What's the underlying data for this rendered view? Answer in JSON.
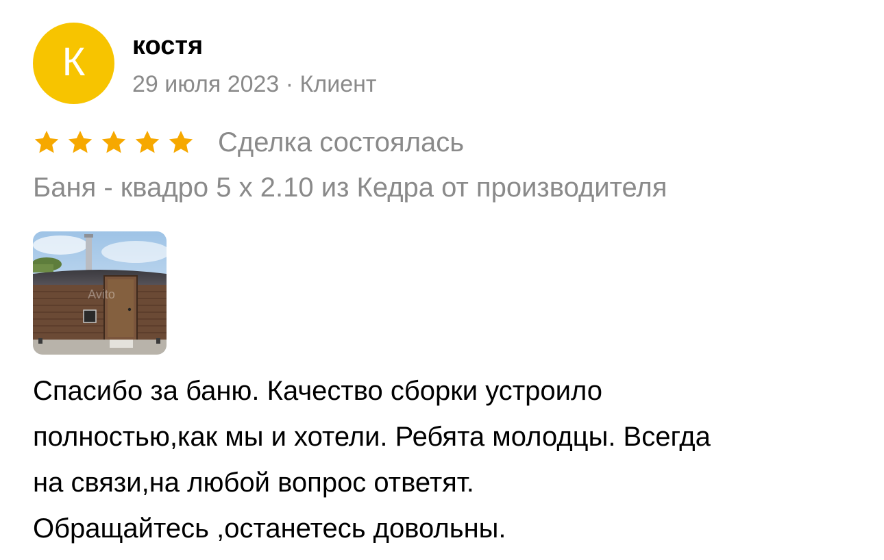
{
  "review": {
    "author": {
      "initial": "К",
      "name": "костя",
      "avatar_color": "#f7c400"
    },
    "meta": "29 июля 2023 · Клиент",
    "rating": {
      "value": 5,
      "max": 5,
      "star_color": "#f6a800"
    },
    "deal_status": "Сделка состоялась",
    "item_title": "Баня - квадро 5 x 2.10 из Кедра от производителя",
    "photo": {
      "icon": "sauna-photo-thumbnail",
      "watermark": "Avito"
    },
    "text": "Спасибо за баню. Качество сборки устроило\nполностью,как мы и хотели. Ребята молодцы.  Всегда\nна связи,на любой вопрос ответят.\nОбращайтесь ,останетесь довольны."
  }
}
